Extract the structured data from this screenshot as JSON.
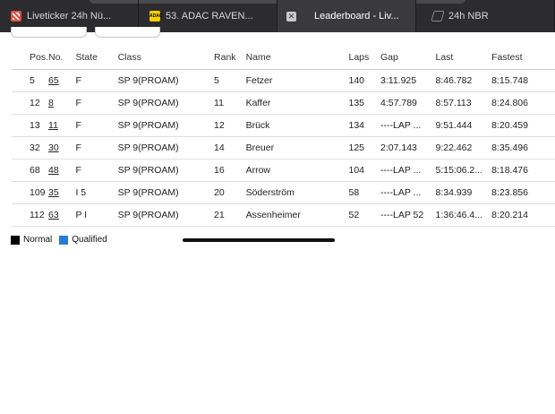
{
  "tabs": [
    {
      "label": "Liveticker 24h Nü...",
      "icon": "checker-flag-icon",
      "active": false
    },
    {
      "label": "53. ADAC RAVEN...",
      "icon": "adac-icon",
      "active": false
    },
    {
      "label": "Leaderboard - Liv...",
      "icon": "close-icon",
      "active": true
    },
    {
      "label": "24h NBR",
      "icon": "nbr-logo-icon",
      "active": false
    }
  ],
  "table": {
    "headers": {
      "pos": "Pos.",
      "no": "No.",
      "state": "State",
      "class": "Class",
      "rank": "Rank",
      "name": "Name",
      "laps": "Laps",
      "gap": "Gap",
      "last": "Last",
      "fastest": "Fastest"
    },
    "rows": [
      {
        "pos": "5",
        "no": "65",
        "state": "F",
        "class": "SP 9(PROAM)",
        "rank": "5",
        "name": "Fetzer",
        "laps": "140",
        "gap": "3:11.925",
        "last": "8:46.782",
        "fastest": "8:15.748"
      },
      {
        "pos": "12",
        "no": "8",
        "state": "F",
        "class": "SP 9(PROAM)",
        "rank": "11",
        "name": "Kaffer",
        "laps": "135",
        "gap": "4:57.789",
        "last": "8:57.113",
        "fastest": "8:24.806"
      },
      {
        "pos": "13",
        "no": "11",
        "state": "F",
        "class": "SP 9(PROAM)",
        "rank": "12",
        "name": "Brück",
        "laps": "134",
        "gap": "----LAP ...",
        "last": "9:51.444",
        "fastest": "8:20.459"
      },
      {
        "pos": "32",
        "no": "30",
        "state": "F",
        "class": "SP 9(PROAM)",
        "rank": "14",
        "name": "Breuer",
        "laps": "125",
        "gap": "2:07.143",
        "last": "9:22.462",
        "fastest": "8:35.496"
      },
      {
        "pos": "68",
        "no": "48",
        "state": "F",
        "class": "SP 9(PROAM)",
        "rank": "16",
        "name": "Arrow",
        "laps": "104",
        "gap": "----LAP ...",
        "last": "5:15:06.2...",
        "fastest": "8:18.476"
      },
      {
        "pos": "109",
        "no": "35",
        "state": "I 5",
        "class": "SP 9(PROAM)",
        "rank": "20",
        "name": "Söderström",
        "laps": "58",
        "gap": "----LAP ...",
        "last": "8:34.939",
        "fastest": "8:23.856"
      },
      {
        "pos": "112",
        "no": "63",
        "state": "P I",
        "class": "SP 9(PROAM)",
        "rank": "21",
        "name": "Assenheimer",
        "laps": "52",
        "gap": "----LAP 52",
        "last": "1:36:46.4...",
        "fastest": "8:20.214"
      }
    ]
  },
  "legend": [
    {
      "label": "Normal",
      "color": "#000000"
    },
    {
      "label": "Qualified",
      "color": "#2a7bd5"
    }
  ]
}
